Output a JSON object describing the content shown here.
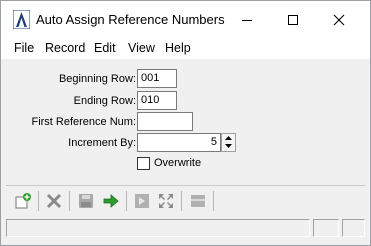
{
  "window": {
    "title": "Auto Assign Reference Numbers"
  },
  "menu": {
    "file": "File",
    "record": "Record",
    "edit": "Edit",
    "view": "View",
    "help": "Help"
  },
  "form": {
    "beginning_row_label": "Beginning Row:",
    "beginning_row_value": "001",
    "ending_row_label": "Ending Row:",
    "ending_row_value": "010",
    "first_reference_label": "First Reference Num:",
    "first_reference_value": "",
    "increment_label": "Increment By:",
    "increment_value": "5",
    "overwrite_label": "Overwrite",
    "overwrite_checked": false
  },
  "toolbar": {
    "icons": [
      "new-record-icon",
      "delete-icon",
      "save-icon",
      "go-arrow-icon",
      "first-record-icon",
      "expand-icon",
      "list-icon"
    ]
  },
  "colors": {
    "go_arrow": "#2e9b2e",
    "disabled_icon": "#9a9a9a",
    "app_icon": "#1f3f7a"
  }
}
